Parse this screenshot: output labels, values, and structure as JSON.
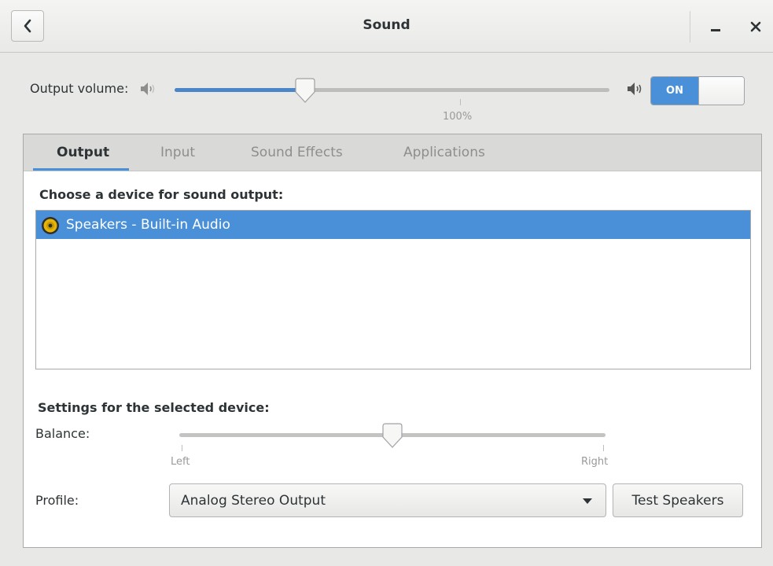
{
  "window": {
    "title": "Sound"
  },
  "output_volume": {
    "label": "Output volume:",
    "level_percent": 30,
    "mark_label": "100%",
    "switch_label": "ON",
    "switch_state": "on"
  },
  "tabs": [
    {
      "label": "Output",
      "active": true
    },
    {
      "label": "Input",
      "active": false
    },
    {
      "label": "Sound Effects",
      "active": false
    },
    {
      "label": "Applications",
      "active": false
    }
  ],
  "output": {
    "choose_device_label": "Choose a device for sound output:",
    "devices": [
      {
        "label": "Speakers - Built-in Audio",
        "selected": true,
        "icon": "speaker-icon"
      }
    ],
    "settings_label": "Settings for the selected device:",
    "balance": {
      "label": "Balance:",
      "value": 0.5,
      "left_label": "Left",
      "right_label": "Right"
    },
    "profile": {
      "label": "Profile:",
      "value": "Analog Stereo Output"
    },
    "test_button_label": "Test Speakers"
  },
  "colors": {
    "accent": "#4a90d9",
    "slider_fill": "#4a86c8"
  }
}
